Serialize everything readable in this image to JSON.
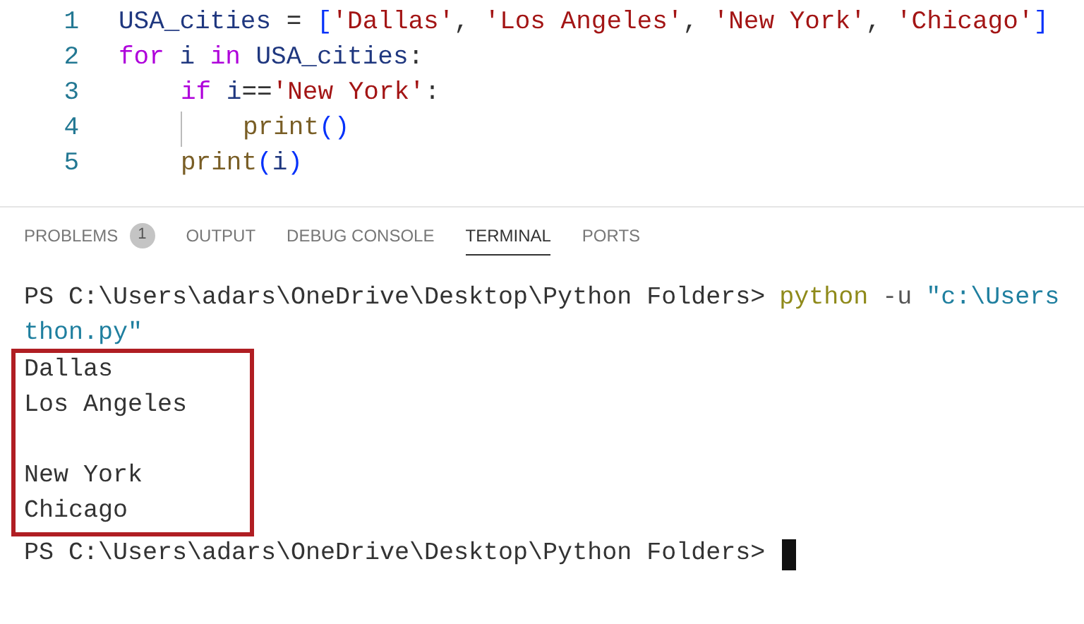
{
  "editor": {
    "lines": [
      {
        "number": "1",
        "tokens": [
          {
            "kind": "name",
            "text": "USA_cities"
          },
          {
            "kind": "plain",
            "text": " = "
          },
          {
            "kind": "bracket",
            "text": "["
          },
          {
            "kind": "string",
            "text": "'Dallas'"
          },
          {
            "kind": "plain",
            "text": ", "
          },
          {
            "kind": "string",
            "text": "'Los Angeles'"
          },
          {
            "kind": "plain",
            "text": ", "
          },
          {
            "kind": "string",
            "text": "'New York'"
          },
          {
            "kind": "plain",
            "text": ", "
          },
          {
            "kind": "string",
            "text": "'Chicago'"
          },
          {
            "kind": "bracket",
            "text": "]"
          }
        ]
      },
      {
        "number": "2",
        "tokens": [
          {
            "kind": "keyword",
            "text": "for "
          },
          {
            "kind": "name",
            "text": "i "
          },
          {
            "kind": "keyword",
            "text": "in "
          },
          {
            "kind": "name",
            "text": "USA_cities"
          },
          {
            "kind": "plain",
            "text": ":"
          }
        ],
        "children": [
          {
            "number": "3",
            "tokens": [
              {
                "kind": "keyword",
                "text": "if "
              },
              {
                "kind": "name",
                "text": "i"
              },
              {
                "kind": "plain",
                "text": "=="
              },
              {
                "kind": "string",
                "text": "'New York'"
              },
              {
                "kind": "plain",
                "text": ":"
              }
            ],
            "children": [
              {
                "number": "4",
                "tokens": [
                  {
                    "kind": "function",
                    "text": "print"
                  },
                  {
                    "kind": "bracket",
                    "text": "()"
                  }
                ]
              }
            ]
          },
          {
            "number": "5",
            "tokens": [
              {
                "kind": "function",
                "text": "print"
              },
              {
                "kind": "bracket",
                "text": "("
              },
              {
                "kind": "name",
                "text": "i"
              },
              {
                "kind": "bracket",
                "text": ")"
              }
            ]
          }
        ]
      }
    ]
  },
  "panel_tabs": [
    {
      "label": "PROBLEMS",
      "badge": "1",
      "selected": false
    },
    {
      "label": "OUTPUT",
      "selected": false
    },
    {
      "label": "DEBUG CONSOLE",
      "selected": false
    },
    {
      "label": "TERMINAL",
      "selected": true
    },
    {
      "label": "PORTS",
      "selected": false
    }
  ],
  "terminal": {
    "command_line": {
      "prompt": "PS C:\\Users\\adars\\OneDrive\\Desktop\\Python Folders>",
      "command": "python",
      "flag": "-u",
      "argument": "\"c:\\Users"
    },
    "wrapped_line": "thon.py\"",
    "output_blocks": [
      {
        "lines": [
          "Dallas",
          "Los Angeles"
        ]
      },
      {
        "lines": [
          "New York",
          "Chicago"
        ]
      }
    ],
    "final_prompt": "PS C:\\Users\\adars\\OneDrive\\Desktop\\Python Folders>"
  }
}
